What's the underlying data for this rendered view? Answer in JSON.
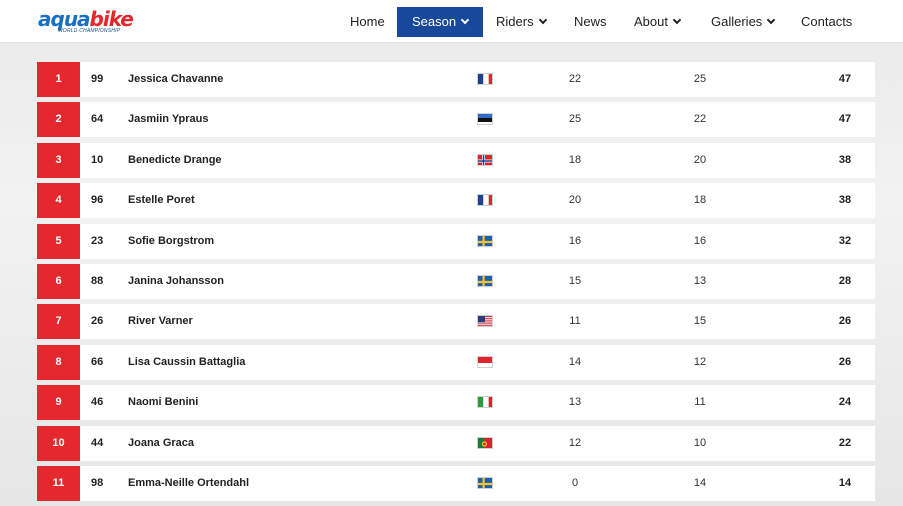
{
  "brand": {
    "logo_word_a": "aqua",
    "logo_word_b": "bike",
    "logo_sub": "WORLD CHAMPIONSHIP",
    "primary_color": "#17489a",
    "accent_color": "#e5282d"
  },
  "nav": {
    "items": [
      {
        "label": "Home",
        "has_dropdown": false,
        "active": false
      },
      {
        "label": "Season",
        "has_dropdown": true,
        "active": true
      },
      {
        "label": "Riders",
        "has_dropdown": true,
        "active": false
      },
      {
        "label": "News",
        "has_dropdown": false,
        "active": false
      },
      {
        "label": "About",
        "has_dropdown": true,
        "active": false
      },
      {
        "label": "Galleries",
        "has_dropdown": true,
        "active": false
      },
      {
        "label": "Contacts",
        "has_dropdown": false,
        "active": false
      }
    ]
  },
  "standings": {
    "rows": [
      {
        "pos": "1",
        "num": "99",
        "name": "Jessica Chavanne",
        "flag": "fr",
        "r1": "22",
        "r2": "25",
        "total": "47"
      },
      {
        "pos": "2",
        "num": "64",
        "name": "Jasmiin Ypraus",
        "flag": "ee",
        "r1": "25",
        "r2": "22",
        "total": "47"
      },
      {
        "pos": "3",
        "num": "10",
        "name": "Benedicte Drange",
        "flag": "no",
        "r1": "18",
        "r2": "20",
        "total": "38"
      },
      {
        "pos": "4",
        "num": "96",
        "name": "Estelle Poret",
        "flag": "fr",
        "r1": "20",
        "r2": "18",
        "total": "38"
      },
      {
        "pos": "5",
        "num": "23",
        "name": "Sofie Borgstrom",
        "flag": "se",
        "r1": "16",
        "r2": "16",
        "total": "32"
      },
      {
        "pos": "6",
        "num": "88",
        "name": "Janina Johansson",
        "flag": "se",
        "r1": "15",
        "r2": "13",
        "total": "28"
      },
      {
        "pos": "7",
        "num": "26",
        "name": "River Varner",
        "flag": "us",
        "r1": "11",
        "r2": "15",
        "total": "26"
      },
      {
        "pos": "8",
        "num": "66",
        "name": "Lisa Caussin Battaglia",
        "flag": "mc",
        "r1": "14",
        "r2": "12",
        "total": "26"
      },
      {
        "pos": "9",
        "num": "46",
        "name": "Naomi Benini",
        "flag": "it",
        "r1": "13",
        "r2": "11",
        "total": "24"
      },
      {
        "pos": "10",
        "num": "44",
        "name": "Joana Graca",
        "flag": "pt",
        "r1": "12",
        "r2": "10",
        "total": "22"
      },
      {
        "pos": "11",
        "num": "98",
        "name": "Emma-Neille Ortendahl",
        "flag": "se",
        "r1": "0",
        "r2": "14",
        "total": "14"
      }
    ]
  }
}
